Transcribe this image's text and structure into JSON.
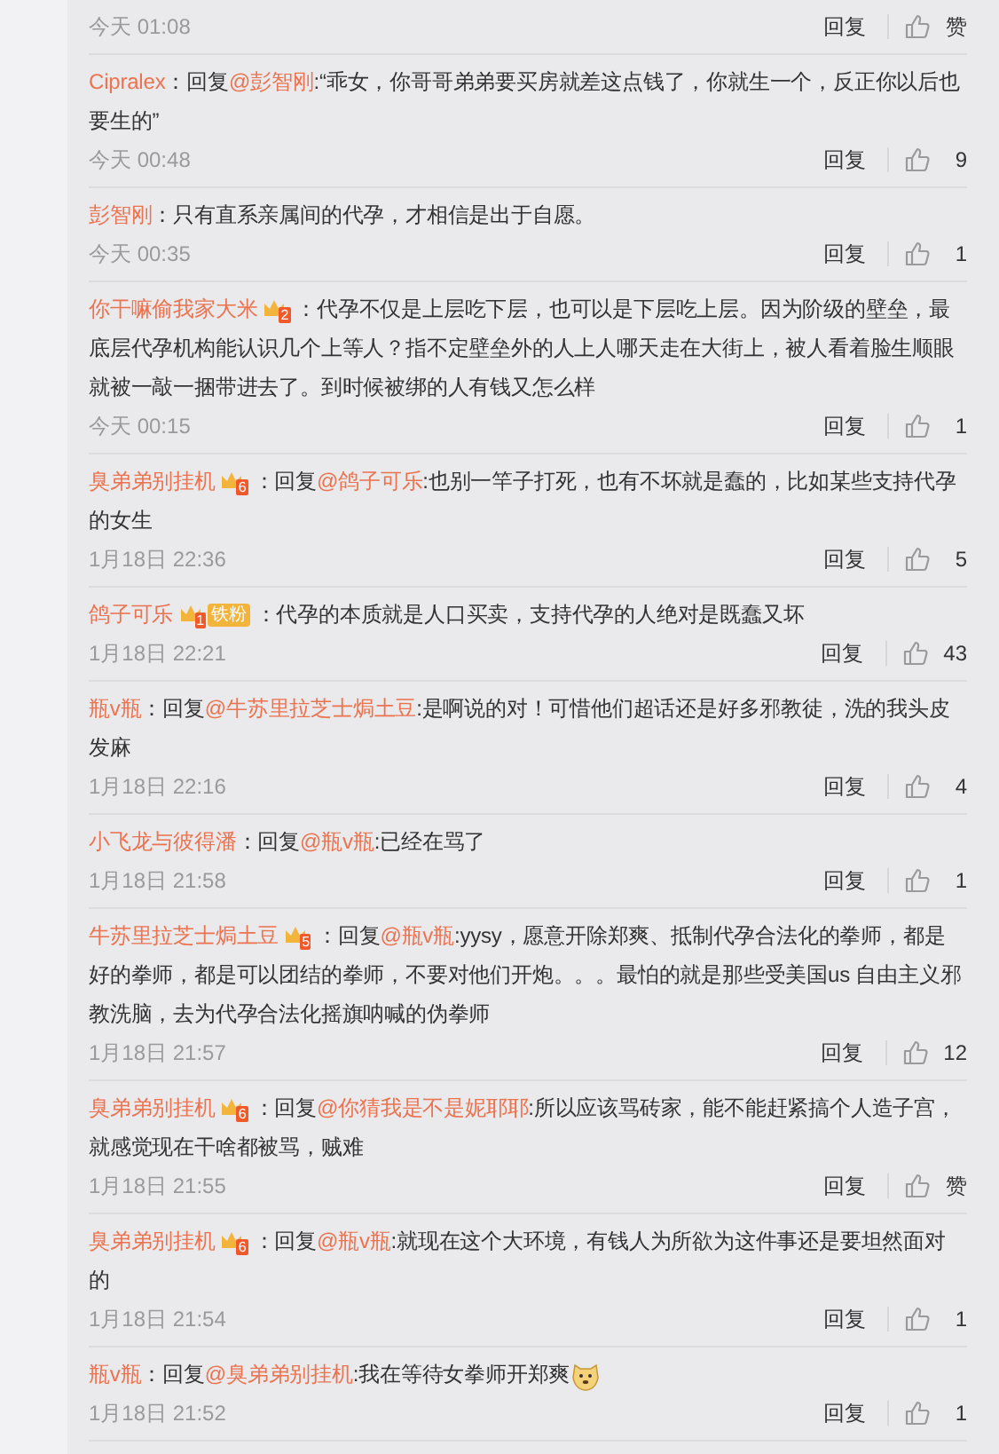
{
  "first_footer": {
    "time": "今天 01:08",
    "reply": "回复",
    "likes": "赞"
  },
  "comments": [
    {
      "user": "Cipralex",
      "colon": "：",
      "reply_label": "回复",
      "mention": "@彭智刚",
      "text": ":“乖女，你哥哥弟弟要买房就差这点钱了，你就生一个，反正你以后也要生的”",
      "time": "今天 00:48",
      "reply": "回复",
      "likes": "9"
    },
    {
      "user": "彭智刚",
      "colon": "：",
      "text": "只有直系亲属间的代孕，才相信是出于自愿。",
      "time": "今天 00:35",
      "reply": "回复",
      "likes": "1"
    },
    {
      "user": "你干嘛偷我家大米",
      "badge": {
        "kind": "crown",
        "level": "2"
      },
      "colon": "：",
      "text": "代孕不仅是上层吃下层，也可以是下层吃上层。因为阶级的壁垒，最底层代孕机构能认识几个上等人？指不定壁垒外的人上人哪天走在大街上，被人看着脸生顺眼就被一敲一捆带进去了。到时候被绑的人有钱又怎么样",
      "time": "今天 00:15",
      "reply": "回复",
      "likes": "1"
    },
    {
      "user": "臭弟弟别挂机",
      "badge": {
        "kind": "crown",
        "level": "6"
      },
      "colon": "：",
      "reply_label": "回复",
      "mention": "@鸽子可乐",
      "text": ":也别一竿子打死，也有不坏就是蠢的，比如某些支持代孕的女生",
      "time": "1月18日 22:36",
      "reply": "回复",
      "likes": "5"
    },
    {
      "user": "鸽子可乐",
      "badge": {
        "kind": "fan",
        "level": "1",
        "label": "铁粉"
      },
      "colon": "：",
      "text": "代孕的本质就是人口买卖，支持代孕的人绝对是既蠢又坏",
      "time": "1月18日 22:21",
      "reply": "回复",
      "likes": "43"
    },
    {
      "user": "瓶v瓶",
      "colon": "：",
      "reply_label": "回复",
      "mention": "@牛苏里拉芝士焗土豆",
      "text": ":是啊说的对！可惜他们超话还是好多邪教徒，洗的我头皮发麻",
      "time": "1月18日 22:16",
      "reply": "回复",
      "likes": "4"
    },
    {
      "user": "小飞龙与彼得潘",
      "colon": "：",
      "reply_label": "回复",
      "mention": "@瓶v瓶",
      "text": ":已经在骂了",
      "time": "1月18日 21:58",
      "reply": "回复",
      "likes": "1"
    },
    {
      "user": "牛苏里拉芝士焗土豆",
      "badge": {
        "kind": "crown",
        "level": "5"
      },
      "colon": "：",
      "reply_label": "回复",
      "mention": "@瓶v瓶",
      "text": ":yysy，愿意开除郑爽、抵制代孕合法化的拳师，都是好的拳师，都是可以团结的拳师，不要对他们开炮。。。最怕的就是那些受美国us 自由主义邪教洗脑，去为代孕合法化摇旗呐喊的伪拳师",
      "time": "1月18日 21:57",
      "reply": "回复",
      "likes": "12"
    },
    {
      "user": "臭弟弟别挂机",
      "badge": {
        "kind": "crown",
        "level": "6"
      },
      "colon": "：",
      "reply_label": "回复",
      "mention": "@你猜我是不是妮耶耶",
      "text": ":所以应该骂砖家，能不能赶紧搞个人造子宫，就感觉现在干啥都被骂，贼难",
      "time": "1月18日 21:55",
      "reply": "回复",
      "likes": "赞"
    },
    {
      "user": "臭弟弟别挂机",
      "badge": {
        "kind": "crown",
        "level": "6"
      },
      "colon": "：",
      "reply_label": "回复",
      "mention": "@瓶v瓶",
      "text": ":就现在这个大环境，有钱人为所欲为这件事还是要坦然面对的",
      "time": "1月18日 21:54",
      "reply": "回复",
      "likes": "1"
    },
    {
      "user": "瓶v瓶",
      "colon": "：",
      "reply_label": "回复",
      "mention": "@臭弟弟别挂机",
      "text": ":我在等待女拳师开郑爽",
      "emoji": true,
      "time": "1月18日 21:52",
      "reply": "回复",
      "likes": "1"
    }
  ]
}
